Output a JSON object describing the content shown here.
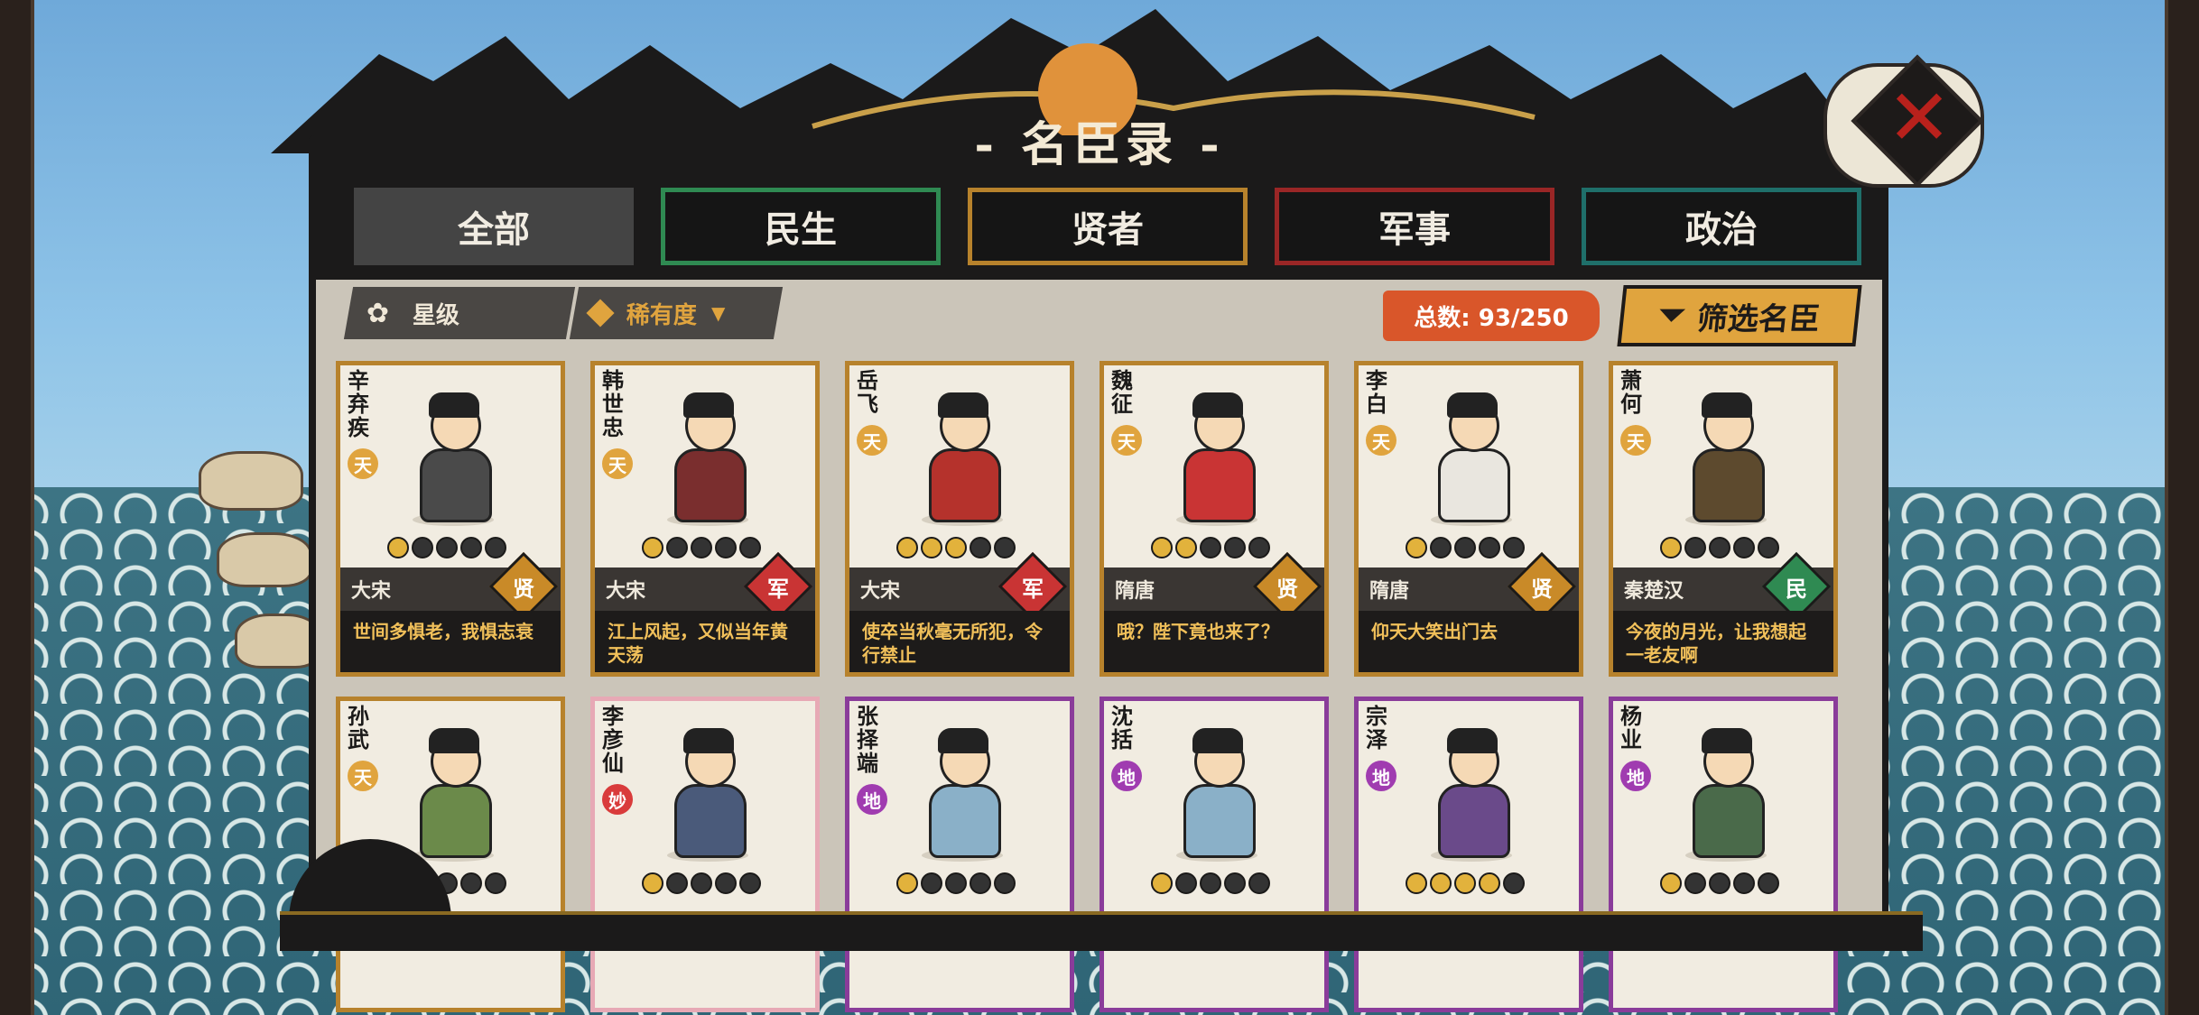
{
  "title": "- 名臣录 -",
  "tabs": [
    {
      "label": "全部",
      "color": "#444444",
      "active": true
    },
    {
      "label": "民生",
      "color": "#2f8a52",
      "active": false
    },
    {
      "label": "贤者",
      "color": "#b7822c",
      "active": false
    },
    {
      "label": "军事",
      "color": "#9a2626",
      "active": false
    },
    {
      "label": "政治",
      "color": "#1f6f6a",
      "active": false
    }
  ],
  "filters": {
    "star_label": "星级",
    "rarity_label": "稀有度"
  },
  "total": "总数: 93/250",
  "screen_button": "筛选名臣",
  "cards": [
    {
      "name": "辛弃疾",
      "rank": "天",
      "stars": 1,
      "dynasty": "大宋",
      "category": "贤",
      "quote": "世间多惧老，我惧志衰",
      "border": "#b7822c"
    },
    {
      "name": "韩世忠",
      "rank": "天",
      "stars": 1,
      "dynasty": "大宋",
      "category": "军",
      "quote": "江上风起，又似当年黄天荡",
      "border": "#b7822c"
    },
    {
      "name": "岳飞",
      "rank": "天",
      "stars": 3,
      "dynasty": "大宋",
      "category": "军",
      "quote": "使卒当秋毫无所犯，令行禁止",
      "border": "#b7822c"
    },
    {
      "name": "魏征",
      "rank": "天",
      "stars": 2,
      "dynasty": "隋唐",
      "category": "贤",
      "quote": "哦？陛下竟也来了？",
      "border": "#b7822c"
    },
    {
      "name": "李白",
      "rank": "天",
      "stars": 1,
      "dynasty": "隋唐",
      "category": "贤",
      "quote": "仰天大笑出门去",
      "border": "#b7822c"
    },
    {
      "name": "萧何",
      "rank": "天",
      "stars": 1,
      "dynasty": "秦楚汉",
      "category": "民",
      "quote": "今夜的月光，让我想起一老友啊",
      "border": "#b7822c"
    },
    {
      "name": "孙武",
      "rank": "天",
      "stars": 1,
      "dynasty": "",
      "category": "",
      "quote": "",
      "border": "#b7822c"
    },
    {
      "name": "李彦仙",
      "rank": "妙",
      "stars": 1,
      "dynasty": "",
      "category": "",
      "quote": "",
      "border": "#e7a9b5"
    },
    {
      "name": "张择端",
      "rank": "地",
      "stars": 1,
      "dynasty": "",
      "category": "",
      "quote": "",
      "border": "#8a3c9a"
    },
    {
      "name": "沈括",
      "rank": "地",
      "stars": 1,
      "dynasty": "",
      "category": "",
      "quote": "",
      "border": "#8a3c9a"
    },
    {
      "name": "宗泽",
      "rank": "地",
      "stars": 4,
      "dynasty": "",
      "category": "",
      "quote": "",
      "border": "#8a3c9a"
    },
    {
      "name": "杨业",
      "rank": "地",
      "stars": 1,
      "dynasty": "",
      "category": "",
      "quote": "",
      "border": "#8a3c9a"
    }
  ],
  "colors": {
    "rank_tian": "#e0a43e",
    "rank_di": "#a03cb0",
    "rank_miao": "#d93b3b",
    "cat_xian": "#c98a28",
    "cat_jun": "#c93434",
    "cat_min": "#2f8a52"
  }
}
